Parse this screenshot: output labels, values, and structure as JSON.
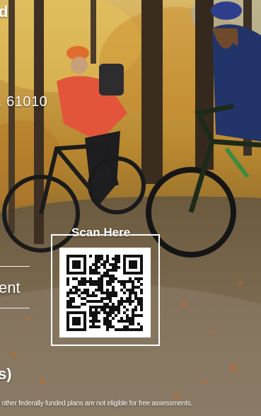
{
  "overlay": {
    "top_fragment": "d",
    "zip_fragment": ". 61010",
    "ment_fragment": "ent",
    "paren_fragment": "s)",
    "disclaimer": "l other federally funded plans are not eligible for free assessments."
  },
  "qr": {
    "label": "Scan Here"
  },
  "colors": {
    "frame": "#ffffff",
    "text": "#ffffff",
    "qr_dark": "#111111"
  }
}
